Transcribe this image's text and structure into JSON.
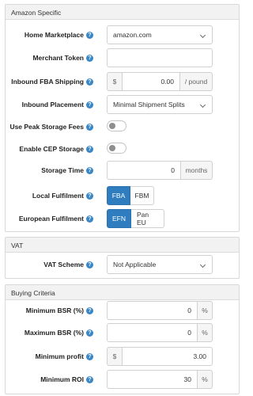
{
  "amazon": {
    "title": "Amazon Specific",
    "home_marketplace": {
      "label": "Home Marketplace",
      "value": "amazon.com"
    },
    "merchant_token": {
      "label": "Merchant Token",
      "value": ""
    },
    "inbound_fba_shipping": {
      "label": "Inbound FBA Shipping",
      "prefix": "$",
      "value": "0.00",
      "suffix": "/ pound"
    },
    "inbound_placement": {
      "label": "Inbound Placement",
      "value": "Minimal Shipment Splits"
    },
    "peak_storage": {
      "label": "Use Peak Storage Fees",
      "checked": false
    },
    "enable_cep": {
      "label": "Enable CEP Storage",
      "checked": false
    },
    "storage_time": {
      "label": "Storage Time",
      "value": "0",
      "suffix": "months"
    },
    "local_fulfilment": {
      "label": "Local Fulfilment",
      "options": [
        "FBA",
        "FBM"
      ],
      "selected": "FBA"
    },
    "european_fulfilment": {
      "label": "European Fulfilment",
      "options": [
        "EFN",
        "Pan EU"
      ],
      "selected": "EFN"
    }
  },
  "vat": {
    "title": "VAT",
    "vat_scheme": {
      "label": "VAT Scheme",
      "value": "Not Applicable"
    }
  },
  "buying": {
    "title": "Buying Criteria",
    "min_bsr": {
      "label": "Minimum BSR (%)",
      "value": "0",
      "suffix": "%"
    },
    "max_bsr": {
      "label": "Maximum BSR (%)",
      "value": "0",
      "suffix": "%"
    },
    "min_profit": {
      "label": "Minimum profit",
      "prefix": "$",
      "value": "3.00"
    },
    "min_roi": {
      "label": "Minimum ROI",
      "value": "30",
      "suffix": "%"
    }
  },
  "help_icon_glyph": "?"
}
